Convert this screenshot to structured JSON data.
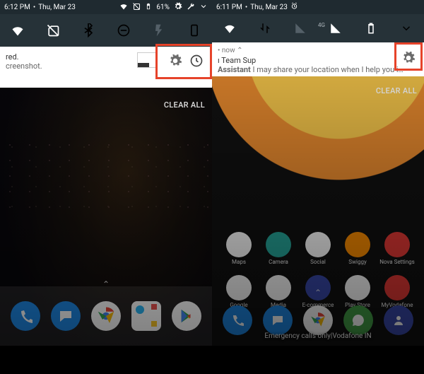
{
  "left": {
    "status": {
      "time": "6:12 PM",
      "date": "Thu, Mar 23",
      "battery": "61%"
    },
    "notif": {
      "meta": "",
      "line1": "red.",
      "line2": "creenshot."
    },
    "clear_all": "CLEAR ALL"
  },
  "right": {
    "status": {
      "time": "6:11 PM",
      "date": "Thu, Mar 23",
      "net_label": "4G"
    },
    "notif": {
      "meta": "• now ⌃",
      "title": "ı Team Sup",
      "body_prefix": "Assistant",
      "body_rest": " I may share your location when I help you i…"
    },
    "clear_all": "CLEAR ALL",
    "apps": {
      "row1": [
        {
          "label": "Maps",
          "name": "maps-icon",
          "cls": "c-white"
        },
        {
          "label": "Camera",
          "name": "camera-icon",
          "cls": "c-teal"
        },
        {
          "label": "Social",
          "name": "social-folder",
          "cls": "c-white"
        },
        {
          "label": "Swiggy",
          "name": "swiggy-icon",
          "cls": "c-orange"
        },
        {
          "label": "Nova Settings",
          "name": "nova-settings-icon",
          "cls": "c-red"
        }
      ],
      "row2": [
        {
          "label": "Google",
          "name": "google-folder",
          "cls": "c-white"
        },
        {
          "label": "Media",
          "name": "media-folder",
          "cls": "c-white"
        },
        {
          "label": "E-commerce",
          "name": "ecommerce-folder",
          "cls": "c-indigo"
        },
        {
          "label": "Play Store",
          "name": "playstore-icon",
          "cls": "c-white"
        },
        {
          "label": "MyVodafone",
          "name": "myvodafone-icon",
          "cls": "c-red"
        }
      ]
    },
    "dock": [
      {
        "name": "phone-icon",
        "cls": "c-blue"
      },
      {
        "name": "messages-icon",
        "cls": "c-blue"
      },
      {
        "name": "chrome-icon",
        "cls": "c-white"
      },
      {
        "name": "whatsapp-icon",
        "cls": "c-green"
      },
      {
        "name": "contacts-icon",
        "cls": "c-indigo"
      }
    ],
    "emergency": "Emergency calls only|Vodafone IN"
  },
  "left_dock": [
    {
      "name": "phone-icon",
      "cls": "c-blue"
    },
    {
      "name": "messages-icon",
      "cls": "c-blue"
    },
    {
      "name": "chrome-icon",
      "cls": "c-white"
    },
    {
      "name": "camera-icon",
      "cls": "c-white sq"
    },
    {
      "name": "playstore-icon",
      "cls": "c-white"
    }
  ]
}
